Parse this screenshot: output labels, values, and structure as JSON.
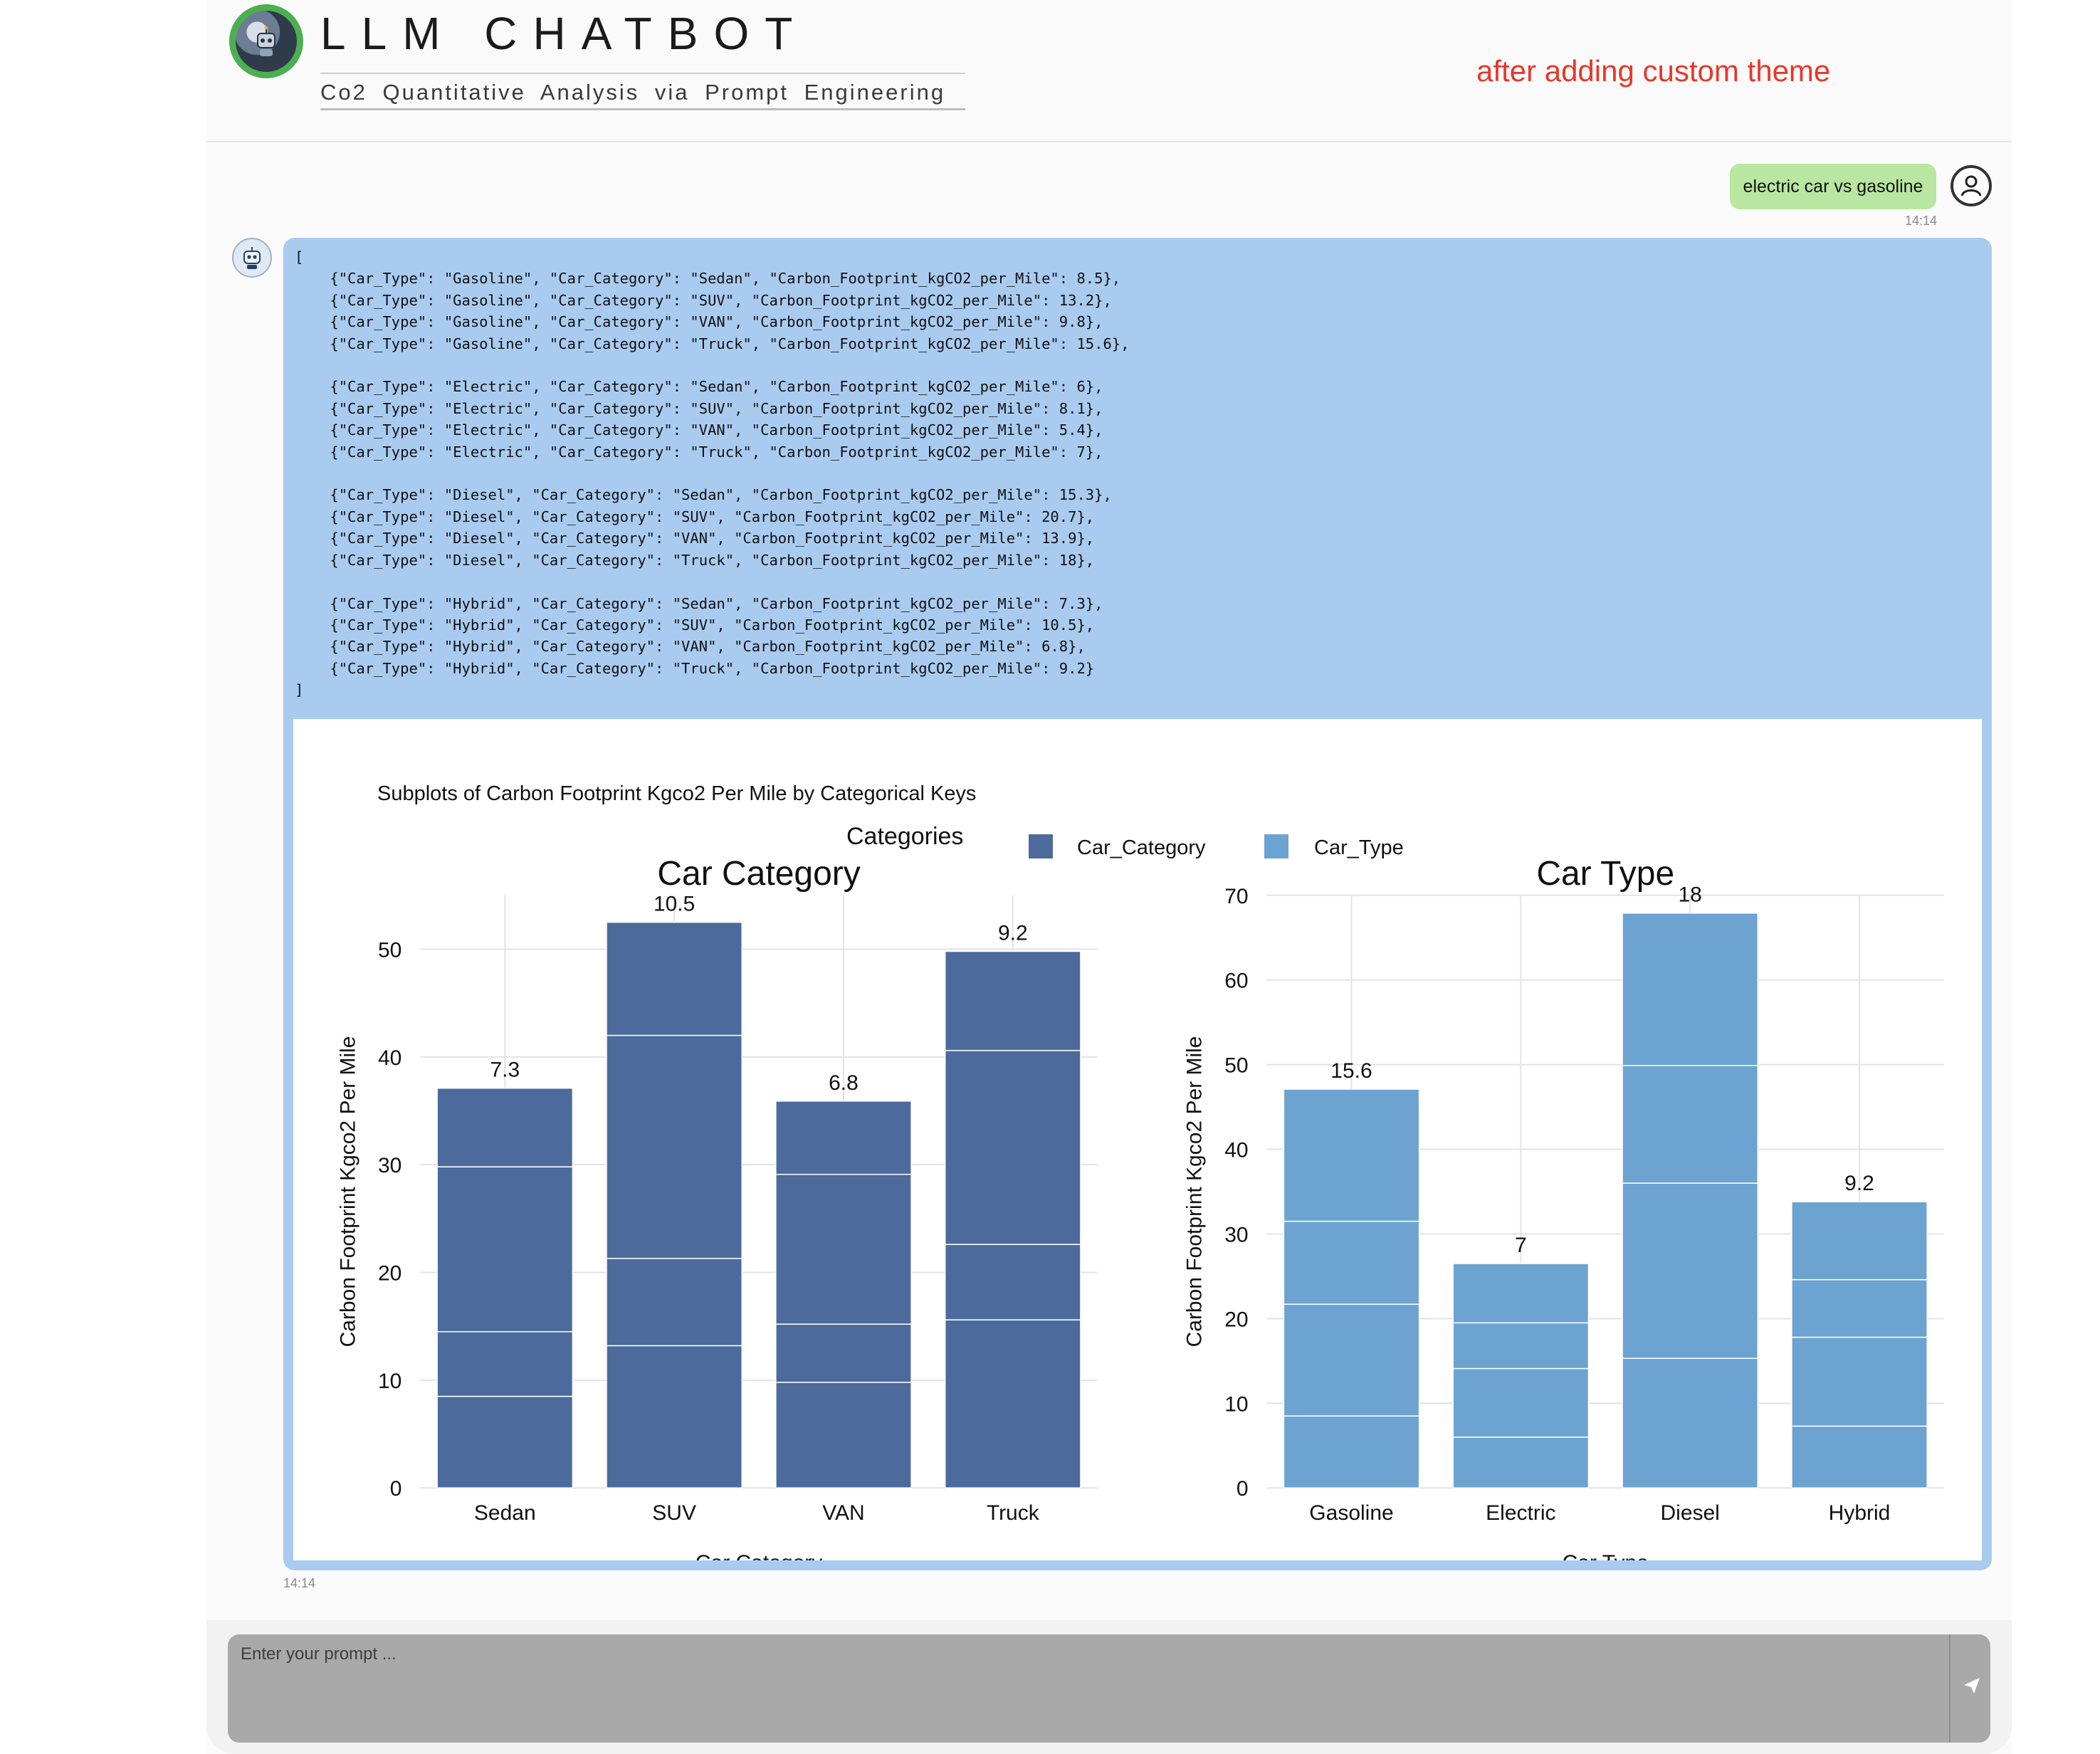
{
  "header": {
    "title": "LLM CHATBOT",
    "subtitle": "Co2 Quantitative Analysis via Prompt Engineering",
    "annotation": "after adding custom theme"
  },
  "messages": {
    "user": {
      "text": "electric car vs gasoline",
      "time": "14:14"
    },
    "bot": {
      "time": "14:14",
      "code": "[\n    {\"Car_Type\": \"Gasoline\", \"Car_Category\": \"Sedan\", \"Carbon_Footprint_kgCO2_per_Mile\": 8.5},\n    {\"Car_Type\": \"Gasoline\", \"Car_Category\": \"SUV\", \"Carbon_Footprint_kgCO2_per_Mile\": 13.2},\n    {\"Car_Type\": \"Gasoline\", \"Car_Category\": \"VAN\", \"Carbon_Footprint_kgCO2_per_Mile\": 9.8},\n    {\"Car_Type\": \"Gasoline\", \"Car_Category\": \"Truck\", \"Carbon_Footprint_kgCO2_per_Mile\": 15.6},\n\n    {\"Car_Type\": \"Electric\", \"Car_Category\": \"Sedan\", \"Carbon_Footprint_kgCO2_per_Mile\": 6},\n    {\"Car_Type\": \"Electric\", \"Car_Category\": \"SUV\", \"Carbon_Footprint_kgCO2_per_Mile\": 8.1},\n    {\"Car_Type\": \"Electric\", \"Car_Category\": \"VAN\", \"Carbon_Footprint_kgCO2_per_Mile\": 5.4},\n    {\"Car_Type\": \"Electric\", \"Car_Category\": \"Truck\", \"Carbon_Footprint_kgCO2_per_Mile\": 7},\n\n    {\"Car_Type\": \"Diesel\", \"Car_Category\": \"Sedan\", \"Carbon_Footprint_kgCO2_per_Mile\": 15.3},\n    {\"Car_Type\": \"Diesel\", \"Car_Category\": \"SUV\", \"Carbon_Footprint_kgCO2_per_Mile\": 20.7},\n    {\"Car_Type\": \"Diesel\", \"Car_Category\": \"VAN\", \"Carbon_Footprint_kgCO2_per_Mile\": 13.9},\n    {\"Car_Type\": \"Diesel\", \"Car_Category\": \"Truck\", \"Carbon_Footprint_kgCO2_per_Mile\": 18},\n\n    {\"Car_Type\": \"Hybrid\", \"Car_Category\": \"Sedan\", \"Carbon_Footprint_kgCO2_per_Mile\": 7.3},\n    {\"Car_Type\": \"Hybrid\", \"Car_Category\": \"SUV\", \"Carbon_Footprint_kgCO2_per_Mile\": 10.5},\n    {\"Car_Type\": \"Hybrid\", \"Car_Category\": \"VAN\", \"Carbon_Footprint_kgCO2_per_Mile\": 6.8},\n    {\"Car_Type\": \"Hybrid\", \"Car_Category\": \"Truck\", \"Carbon_Footprint_kgCO2_per_Mile\": 9.2}\n]"
    }
  },
  "chart_data": {
    "title": "Subplots of Carbon Footprint Kgco2 Per Mile by Categorical Keys",
    "legend": {
      "title": "Categories",
      "placement": "top",
      "entries": [
        {
          "name": "Car_Category",
          "color": "#4c6b9c"
        },
        {
          "name": "Car_Type",
          "color": "#6ca3d1"
        }
      ]
    },
    "subplots": [
      {
        "title": "Car Category",
        "type": "bar",
        "stacked": true,
        "series_name": "Car_Category",
        "color": "#4c6b9c",
        "xlabel": "Car Category",
        "ylabel": "Carbon Footprint Kgco2 Per Mile",
        "ylim": [
          0,
          55
        ],
        "yticks": [
          0,
          10,
          20,
          30,
          40,
          50
        ],
        "grid": true,
        "categories": [
          "Sedan",
          "SUV",
          "VAN",
          "Truck"
        ],
        "segments": [
          [
            8.5,
            6,
            15.3,
            7.3
          ],
          [
            13.2,
            8.1,
            20.7,
            10.5
          ],
          [
            9.8,
            5.4,
            13.9,
            6.8
          ],
          [
            15.6,
            7,
            18,
            9.2
          ]
        ],
        "top_labels": [
          "7.3",
          "10.5",
          "6.8",
          "9.2"
        ]
      },
      {
        "title": "Car Type",
        "type": "bar",
        "stacked": true,
        "series_name": "Car_Type",
        "color": "#6ca3d1",
        "xlabel": "Car Type",
        "ylabel": "Carbon Footprint Kgco2 Per Mile",
        "ylim": [
          0,
          70
        ],
        "yticks": [
          0,
          10,
          20,
          30,
          40,
          50,
          60,
          70
        ],
        "grid": true,
        "categories": [
          "Gasoline",
          "Electric",
          "Diesel",
          "Hybrid"
        ],
        "segments": [
          [
            8.5,
            13.2,
            9.8,
            15.6
          ],
          [
            6,
            8.1,
            5.4,
            7
          ],
          [
            15.3,
            20.7,
            13.9,
            18
          ],
          [
            7.3,
            10.5,
            6.8,
            9.2
          ]
        ],
        "top_labels": [
          "15.6",
          "7",
          "18",
          "9.2"
        ]
      }
    ]
  },
  "composer": {
    "placeholder": "Enter your prompt ...",
    "send_icon": "send-icon"
  }
}
